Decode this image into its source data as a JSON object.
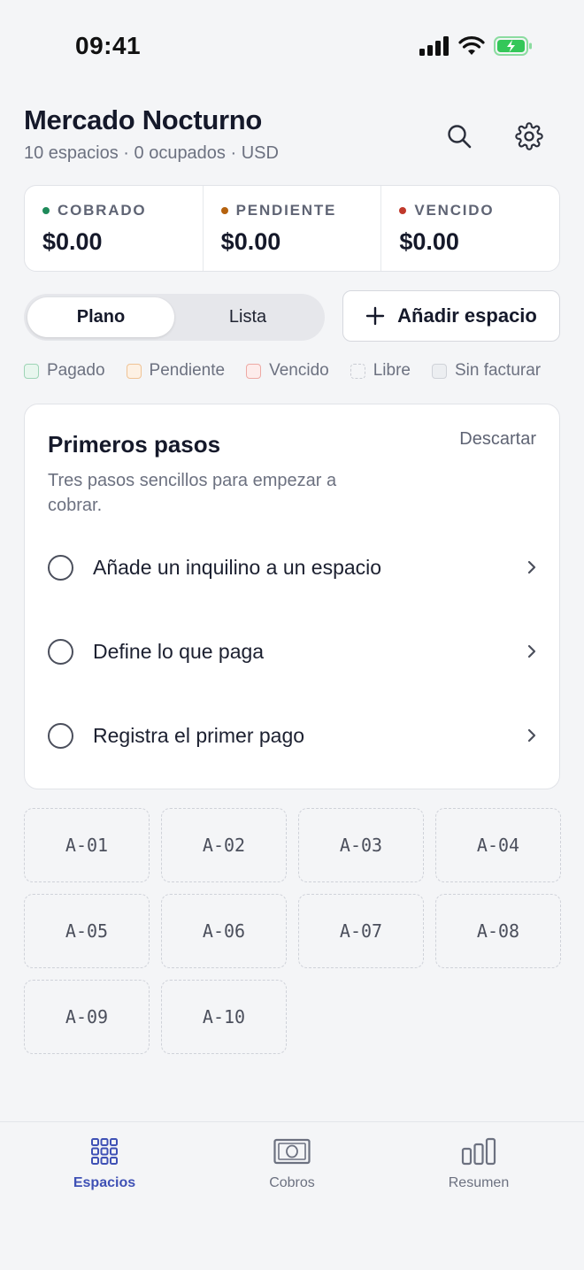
{
  "status_bar": {
    "time": "09:41"
  },
  "header": {
    "title": "Mercado Nocturno",
    "subtitle": "10 espacios · 0 ocupados · USD"
  },
  "stats": [
    {
      "label": "COBRADO",
      "value": "$0.00",
      "color": "#1e8a5a"
    },
    {
      "label": "PENDIENTE",
      "value": "$0.00",
      "color": "#b5620e"
    },
    {
      "label": "VENCIDO",
      "value": "$0.00",
      "color": "#c0392b"
    }
  ],
  "view_toggle": {
    "options": [
      "Plano",
      "Lista"
    ],
    "selected": "Plano"
  },
  "add_button": {
    "label": "Añadir espacio"
  },
  "legend": [
    {
      "label": "Pagado",
      "fill": "#e8f6ee",
      "border": "#9ed4b6",
      "style": "solid"
    },
    {
      "label": "Pendiente",
      "fill": "#fdf1e4",
      "border": "#efc395",
      "style": "solid"
    },
    {
      "label": "Vencido",
      "fill": "#fdeceb",
      "border": "#eda9a4",
      "style": "solid"
    },
    {
      "label": "Libre",
      "fill": "transparent",
      "border": "#c9ccd3",
      "style": "dashed"
    },
    {
      "label": "Sin facturar",
      "fill": "#eceef1",
      "border": "#cfd2d8",
      "style": "solid"
    }
  ],
  "onboarding": {
    "title": "Primeros pasos",
    "dismiss": "Descartar",
    "description": "Tres pasos sencillos para empezar a cobrar.",
    "steps": [
      "Añade un inquilino a un espacio",
      "Define lo que paga",
      "Registra el primer pago"
    ]
  },
  "spaces": [
    "A-01",
    "A-02",
    "A-03",
    "A-04",
    "A-05",
    "A-06",
    "A-07",
    "A-08",
    "A-09",
    "A-10"
  ],
  "tabs": [
    {
      "label": "Espacios",
      "icon": "grid-icon",
      "active": true
    },
    {
      "label": "Cobros",
      "icon": "banknote-icon",
      "active": false
    },
    {
      "label": "Resumen",
      "icon": "bar-chart-icon",
      "active": false
    }
  ],
  "colors": {
    "accent": "#3f51b5",
    "battery": "#34c759"
  }
}
